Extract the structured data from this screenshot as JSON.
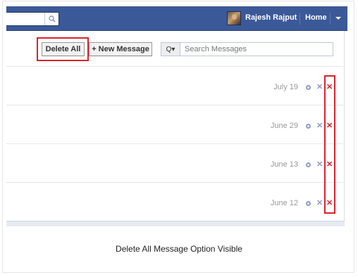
{
  "topbar": {
    "user_name": "Rajesh Rajput",
    "home_label": "Home",
    "search_icon": "magnifier-icon",
    "menu_icon": "chevron-down-icon",
    "bar_color": "#3b5998"
  },
  "toolbar": {
    "delete_all_label": "Delete All",
    "new_message_label": "+ New Message",
    "search_placeholder": "Search Messages",
    "search_dropdown_label": "Q▾"
  },
  "messages": [
    {
      "date": "July 19"
    },
    {
      "date": "June 29"
    },
    {
      "date": "June 13"
    },
    {
      "date": "June 12"
    }
  ],
  "highlight_color": "#d9232b",
  "caption": "Delete All Message Option Visible"
}
